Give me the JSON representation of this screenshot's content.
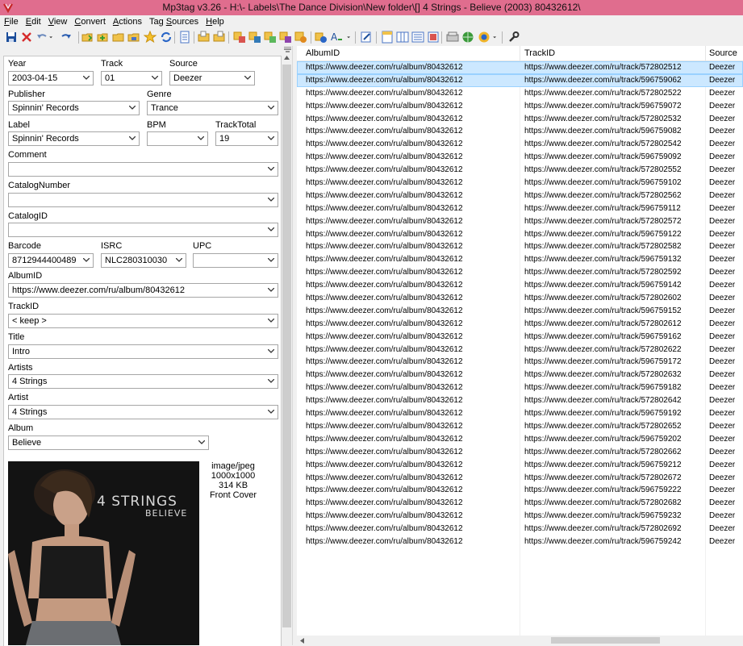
{
  "window": {
    "title": "Mp3tag v3.26  -  H:\\- Labels\\The Dance Division\\New folder\\[] 4 Strings - Believe (2003) 80432612\\"
  },
  "menu": [
    {
      "label": "File",
      "u": "F",
      "rest": "ile"
    },
    {
      "label": "Edit",
      "u": "E",
      "rest": "dit"
    },
    {
      "label": "View",
      "u": "V",
      "rest": "iew"
    },
    {
      "label": "Convert",
      "u": "C",
      "rest": "onvert"
    },
    {
      "label": "Actions",
      "u": "A",
      "rest": "ctions"
    },
    {
      "label": "Tag Sources",
      "pre": "Tag ",
      "u": "S",
      "rest": "ources"
    },
    {
      "label": "Help",
      "u": "H",
      "rest": "elp"
    }
  ],
  "fields": {
    "year": {
      "label": "Year",
      "value": "2003-04-15"
    },
    "track": {
      "label": "Track",
      "value": "01"
    },
    "source": {
      "label": "Source",
      "value": "Deezer"
    },
    "publisher": {
      "label": "Publisher",
      "value": "Spinnin' Records"
    },
    "genre": {
      "label": "Genre",
      "value": "Trance"
    },
    "label": {
      "label": "Label",
      "value": "Spinnin' Records"
    },
    "bpm": {
      "label": "BPM",
      "value": ""
    },
    "tracktotal": {
      "label": "TrackTotal",
      "value": "19"
    },
    "comment": {
      "label": "Comment",
      "value": ""
    },
    "catalognumber": {
      "label": "CatalogNumber",
      "value": ""
    },
    "catalogid": {
      "label": "CatalogID",
      "value": ""
    },
    "barcode": {
      "label": "Barcode",
      "value": "8712944400489"
    },
    "isrc": {
      "label": "ISRC",
      "value": "NLC280310030"
    },
    "upc": {
      "label": "UPC",
      "value": ""
    },
    "albumid": {
      "label": "AlbumID",
      "value": "https://www.deezer.com/ru/album/80432612"
    },
    "trackid": {
      "label": "TrackID",
      "value": "< keep >"
    },
    "title": {
      "label": "Title",
      "value": "Intro"
    },
    "artists": {
      "label": "Artists",
      "value": "4 Strings"
    },
    "artist": {
      "label": "Artist",
      "value": "4 Strings"
    },
    "album": {
      "label": "Album",
      "value": "Believe"
    }
  },
  "cover": {
    "line1": "4 STRINGS",
    "line2": "BELIEVE",
    "mime": "image/jpeg",
    "dims": "1000x1000",
    "size": "314 KB",
    "type": "Front Cover"
  },
  "list": {
    "columns": [
      "AlbumID",
      "TrackID",
      "Source"
    ],
    "album_url": "https://www.deezer.com/ru/album/80432612",
    "source": "Deezer",
    "selected_rows": [
      0,
      1
    ],
    "track_urls": [
      "https://www.deezer.com/ru/track/572802512",
      "https://www.deezer.com/ru/track/596759062",
      "https://www.deezer.com/ru/track/572802522",
      "https://www.deezer.com/ru/track/596759072",
      "https://www.deezer.com/ru/track/572802532",
      "https://www.deezer.com/ru/track/596759082",
      "https://www.deezer.com/ru/track/572802542",
      "https://www.deezer.com/ru/track/596759092",
      "https://www.deezer.com/ru/track/572802552",
      "https://www.deezer.com/ru/track/596759102",
      "https://www.deezer.com/ru/track/572802562",
      "https://www.deezer.com/ru/track/596759112",
      "https://www.deezer.com/ru/track/572802572",
      "https://www.deezer.com/ru/track/596759122",
      "https://www.deezer.com/ru/track/572802582",
      "https://www.deezer.com/ru/track/596759132",
      "https://www.deezer.com/ru/track/572802592",
      "https://www.deezer.com/ru/track/596759142",
      "https://www.deezer.com/ru/track/572802602",
      "https://www.deezer.com/ru/track/596759152",
      "https://www.deezer.com/ru/track/572802612",
      "https://www.deezer.com/ru/track/596759162",
      "https://www.deezer.com/ru/track/572802622",
      "https://www.deezer.com/ru/track/596759172",
      "https://www.deezer.com/ru/track/572802632",
      "https://www.deezer.com/ru/track/596759182",
      "https://www.deezer.com/ru/track/572802642",
      "https://www.deezer.com/ru/track/596759192",
      "https://www.deezer.com/ru/track/572802652",
      "https://www.deezer.com/ru/track/596759202",
      "https://www.deezer.com/ru/track/572802662",
      "https://www.deezer.com/ru/track/596759212",
      "https://www.deezer.com/ru/track/572802672",
      "https://www.deezer.com/ru/track/596759222",
      "https://www.deezer.com/ru/track/572802682",
      "https://www.deezer.com/ru/track/596759232",
      "https://www.deezer.com/ru/track/572802692",
      "https://www.deezer.com/ru/track/596759242"
    ]
  },
  "colors": {
    "titlebar": "#e06d8e",
    "selection": "#cce8ff",
    "selection_border": "#99d1ff"
  },
  "toolbar_icons": [
    "save-icon",
    "delete-icon",
    "undo-icon",
    "dropdown-icon",
    "redo-icon",
    "open-folder-icon",
    "add-folder-icon",
    "folder-icon",
    "favorites-folder-icon",
    "star-icon",
    "refresh-icon",
    "playlist-icon",
    "folder-export-icon",
    "folder-import-icon",
    "tag-to-filename-icon",
    "filename-to-tag-icon",
    "tag-to-tag-icon",
    "text-to-tag-icon",
    "export-icon",
    "actions-icon",
    "font-case-icon",
    "dropdown-icon",
    "edit-icon",
    "tag-panel-icon",
    "columns-icon",
    "extended-tags-icon",
    "cover-icon",
    "web-sources-icon",
    "globe-icon",
    "dropdown-icon",
    "settings-icon"
  ]
}
